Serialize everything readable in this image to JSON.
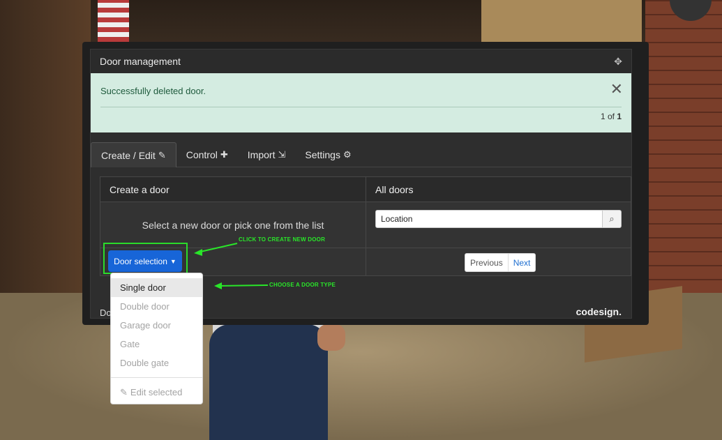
{
  "window": {
    "title": "Door management"
  },
  "alert": {
    "message": "Successfully deleted door.",
    "pager_prefix": "1 of",
    "pager_total": "1"
  },
  "tabs": [
    {
      "label": "Create / Edit",
      "icon": "edit-icon"
    },
    {
      "label": "Control",
      "icon": "gamepad-icon"
    },
    {
      "label": "Import",
      "icon": "import-icon"
    },
    {
      "label": "Settings",
      "icon": "gear-icon"
    }
  ],
  "create_card": {
    "title": "Create a door",
    "hint": "Select a new door or pick one from the list",
    "button_label": "Door selection"
  },
  "doors_card": {
    "title": "All doors",
    "search_value": "Location",
    "prev_label": "Previous",
    "next_label": "Next"
  },
  "dropdown": {
    "items": [
      "Single door",
      "Double door",
      "Garage door",
      "Gate",
      "Double gate"
    ],
    "edit_label": "Edit selected"
  },
  "bottombar": {
    "left_label": "Do",
    "brand": "codesign."
  },
  "annotations": {
    "create": "CLICK TO CREATE NEW DOOR",
    "choose": "CHOOSE A DOOR TYPE"
  },
  "colors": {
    "accent": "#1765d8",
    "highlight": "#2adb2a",
    "alert_bg": "#d4ece1"
  }
}
